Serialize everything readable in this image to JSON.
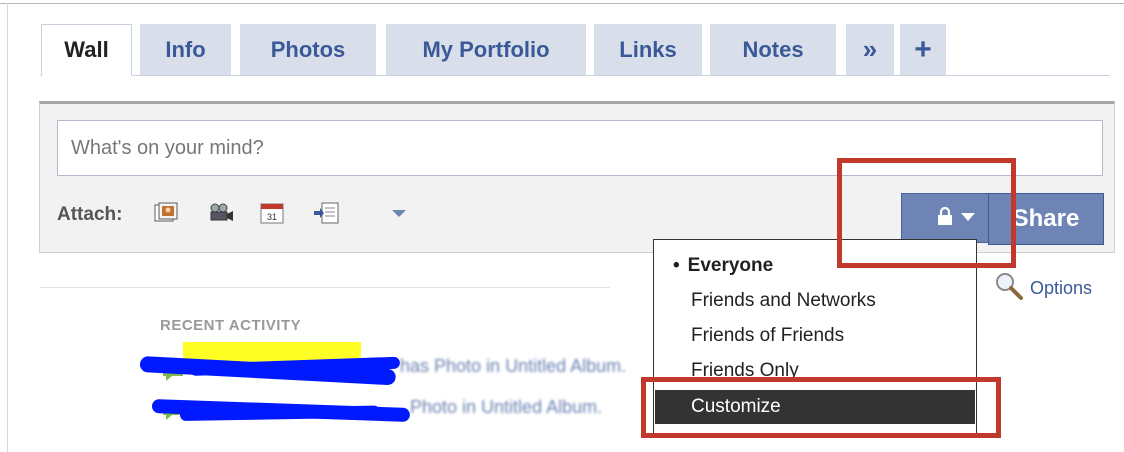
{
  "tabs": [
    {
      "label": "Wall",
      "active": true
    },
    {
      "label": "Info",
      "active": false
    },
    {
      "label": "Photos",
      "active": false
    },
    {
      "label": "My Portfolio",
      "active": false
    },
    {
      "label": "Links",
      "active": false
    },
    {
      "label": "Notes",
      "active": false
    },
    {
      "label": "»",
      "active": false
    },
    {
      "label": "+",
      "active": false
    }
  ],
  "composer": {
    "placeholder": "What's on your mind?",
    "attach_label": "Attach:",
    "attach_icons": [
      "photo-icon",
      "video-icon",
      "event-icon",
      "link-icon"
    ],
    "share_label": "Share",
    "privacy_icon": "lock-icon"
  },
  "privacy_menu": {
    "items": [
      {
        "label": "Everyone",
        "selected": true
      },
      {
        "label": "Friends and Networks",
        "selected": false
      },
      {
        "label": "Friends of Friends",
        "selected": false
      },
      {
        "label": "Friends Only",
        "selected": false
      },
      {
        "label": "Customize",
        "selected": false,
        "highlighted": true
      }
    ]
  },
  "feed": {
    "options_label": "Options",
    "recent_activity_heading": "RECENT ACTIVITY",
    "items": [
      {
        "text": "has Photo in Untitled Album."
      },
      {
        "text": "Photo in Untitled Album."
      }
    ]
  },
  "colors": {
    "accent": "#3b5998",
    "button": "#6d84b4",
    "annotation": "#c0392b",
    "redaction": "#0019ff",
    "highlight": "#ffff00"
  }
}
